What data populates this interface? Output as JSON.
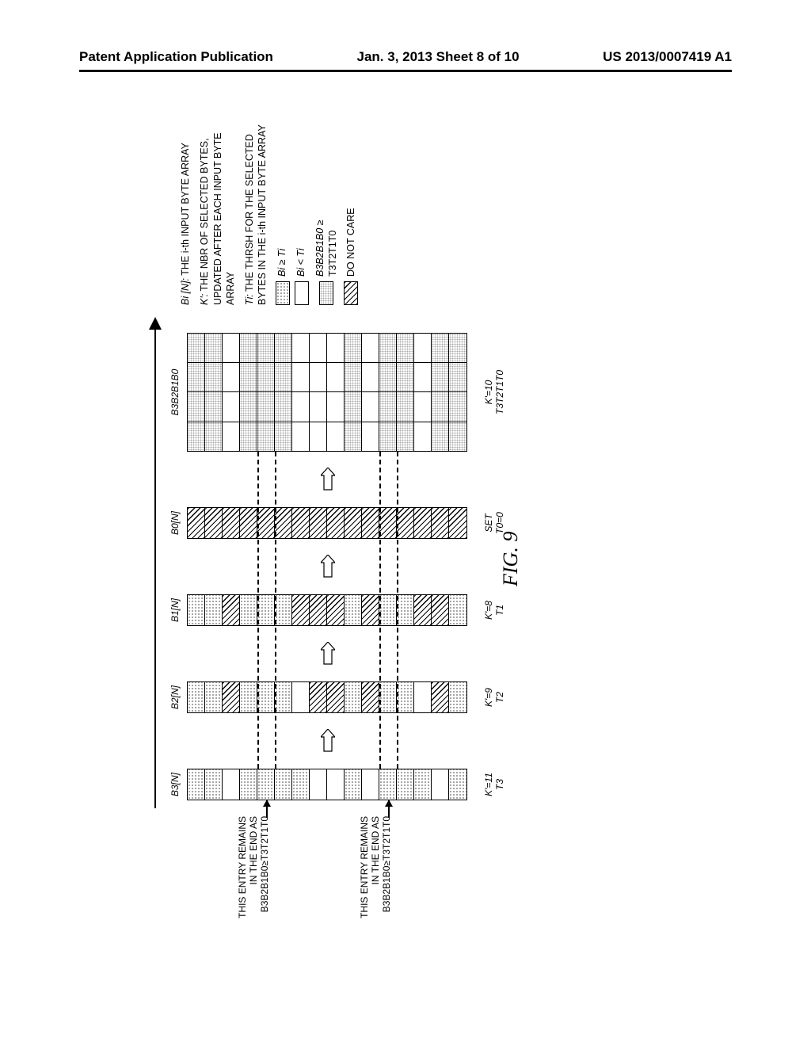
{
  "header": {
    "left": "Patent Application Publication",
    "center": "Jan. 3, 2013  Sheet 8 of 10",
    "right": "US 2013/0007419 A1"
  },
  "columns": {
    "b3": {
      "label": "B3[N]",
      "bottom1": "K'=11",
      "bottom2": "T3"
    },
    "b2": {
      "label": "B2[N]",
      "bottom1": "K'=9",
      "bottom2": "T2"
    },
    "b1": {
      "label": "B1[N]",
      "bottom1": "K'=8",
      "bottom2": "T1"
    },
    "b0": {
      "label": "B0[N]",
      "bottom1": "SET",
      "bottom2": "T0=0"
    },
    "comb": {
      "label": "B3B2B1B0",
      "bottom1": "K'=10",
      "bottom2": "T3T2T1T0"
    }
  },
  "callouts": {
    "line1": "THIS ENTRY REMAINS",
    "line2": "IN THE END AS",
    "line3": "B3B2B1B0≥T3T2T1T0"
  },
  "legend": {
    "def1a": "Bi [N]:",
    "def1b": " THE i-th INPUT BYTE ARRAY",
    "def2a": "K':",
    "def2b": " THE NBR OF SELECTED BYTES, UPDATED AFTER EACH INPUT BYTE ARRAY",
    "def3a": "Ti:",
    "def3b": " THE THRSH FOR THE SELECTED BYTES IN THE i-th INPUT BYTE ARRAY",
    "row_ge": "Bi ≥ Ti",
    "row_lt": "Bi < Ti",
    "row_comb1": "B3B2B1B0 ≥",
    "row_comb2": "T3T2T1T0",
    "row_dnc": "DO NOT CARE"
  },
  "figure_label": "FIG. 9",
  "chart_data": {
    "type": "table",
    "description": "Five columnar byte-array diagrams showing threshold comparison states across 16 entries",
    "rows": 16,
    "columns": [
      {
        "name": "B3[N]",
        "k_prime": 11,
        "threshold": "T3",
        "states": [
          "ge",
          "ge",
          "lt",
          "ge",
          "ge",
          "ge",
          "ge",
          "lt",
          "lt",
          "ge",
          "lt",
          "ge",
          "ge",
          "ge",
          "lt",
          "ge"
        ]
      },
      {
        "name": "B2[N]",
        "k_prime": 9,
        "threshold": "T2",
        "states": [
          "ge",
          "ge",
          "dnc",
          "ge",
          "ge",
          "ge",
          "lt",
          "dnc",
          "dnc",
          "ge",
          "dnc",
          "ge",
          "ge",
          "lt",
          "dnc",
          "ge"
        ]
      },
      {
        "name": "B1[N]",
        "k_prime": 8,
        "threshold": "T1",
        "states": [
          "ge",
          "ge",
          "dnc",
          "ge",
          "ge",
          "ge",
          "dnc",
          "dnc",
          "dnc",
          "ge",
          "dnc",
          "ge",
          "ge",
          "dnc",
          "dnc",
          "ge"
        ]
      },
      {
        "name": "B0[N]",
        "k_prime": null,
        "threshold": "T0=0",
        "states": [
          "dnc",
          "dnc",
          "dnc",
          "dnc",
          "dnc",
          "dnc",
          "dnc",
          "dnc",
          "dnc",
          "dnc",
          "dnc",
          "dnc",
          "dnc",
          "dnc",
          "dnc",
          "dnc"
        ]
      },
      {
        "name": "B3B2B1B0",
        "k_prime": 10,
        "threshold": "T3T2T1T0",
        "states": [
          "comb",
          "comb",
          "lt",
          "comb",
          "comb",
          "comb",
          "lt",
          "lt",
          "lt",
          "comb",
          "lt",
          "comb",
          "comb",
          "lt",
          "comb",
          "comb"
        ],
        "subparts": 4
      }
    ],
    "callout_rows": [
      4,
      11
    ],
    "legend_states": {
      "ge": "Bi ≥ Ti",
      "lt": "Bi < Ti",
      "comb": "B3B2B1B0 ≥ T3T2T1T0",
      "dnc": "DO NOT CARE"
    }
  }
}
